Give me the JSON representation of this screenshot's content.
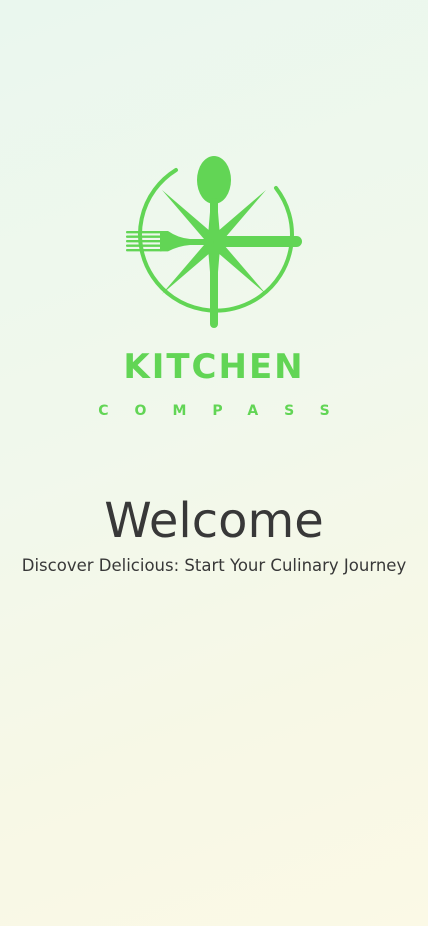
{
  "brand": {
    "name": "KITCHEN",
    "subtitle": "COMPASS",
    "logo_icon": "compass-cutlery-icon",
    "accent_color": "#62d555"
  },
  "welcome": {
    "title": "Welcome",
    "tagline": "Discover Delicious: Start Your Culinary Journey"
  },
  "colors": {
    "text": "#383838",
    "background_top": "#eaf7ee",
    "background_bottom": "#fbf9e6"
  }
}
